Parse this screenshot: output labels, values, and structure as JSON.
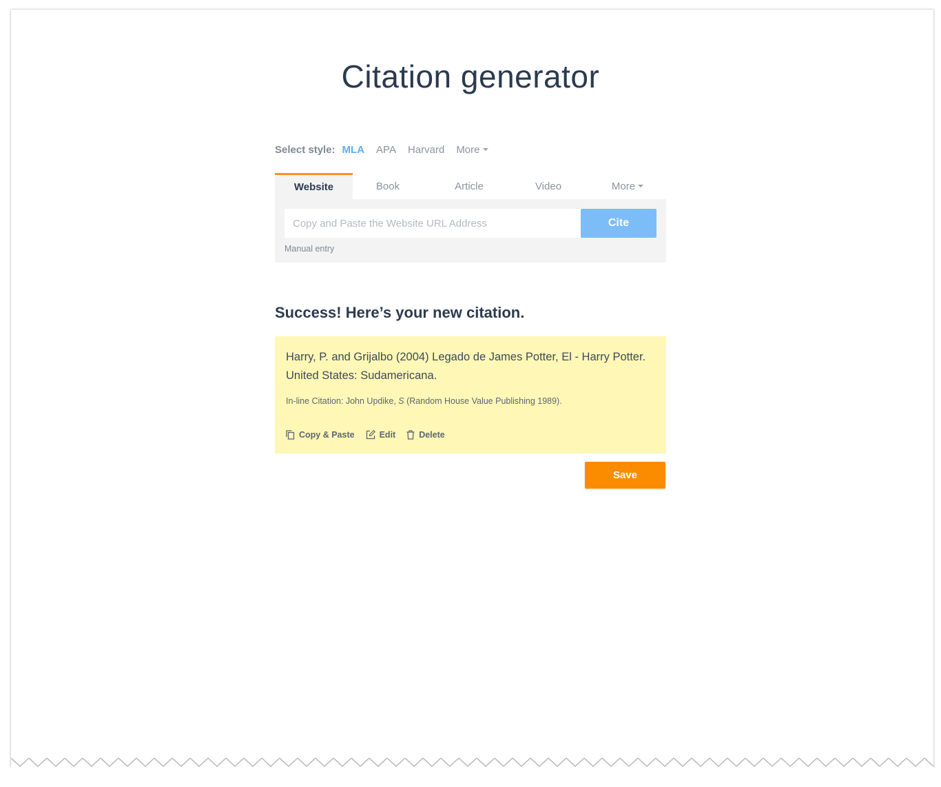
{
  "page": {
    "title": "Citation generator"
  },
  "style_selector": {
    "label": "Select style:",
    "options": [
      "MLA",
      "APA",
      "Harvard",
      "More"
    ],
    "selected": "MLA"
  },
  "tabs": {
    "items": [
      "Website",
      "Book",
      "Article",
      "Video",
      "More"
    ],
    "active": "Website"
  },
  "cite_form": {
    "url_placeholder": "Copy and Paste the Website URL Address",
    "url_value": "",
    "cite_label": "Cite",
    "manual_entry_label": "Manual entry"
  },
  "result": {
    "heading": "Success! Here’s your new citation.",
    "citation": "Harry, P. and Grijalbo (2004) Legado de James Potter, El - Harry Potter. United States: Sudamericana.",
    "inline_prefix": "In-line Citation: John Updike, ",
    "inline_italic": "S",
    "inline_suffix": " (Random House Value Publishing 1989).",
    "actions": {
      "copy_label": "Copy & Paste",
      "edit_label": "Edit",
      "delete_label": "Delete"
    }
  },
  "save_label": "Save",
  "colors": {
    "accent_blue": "#5aaef7",
    "cite_button": "#7cbdf8",
    "tab_active_border": "#f7931e",
    "save_button": "#fb8c00",
    "citation_card": "#fff7b5",
    "text_dark": "#2b3a4e"
  },
  "icons": {
    "copy": "copy-icon",
    "edit": "edit-icon",
    "delete": "trash-icon",
    "dropdown": "caret-down-icon"
  }
}
